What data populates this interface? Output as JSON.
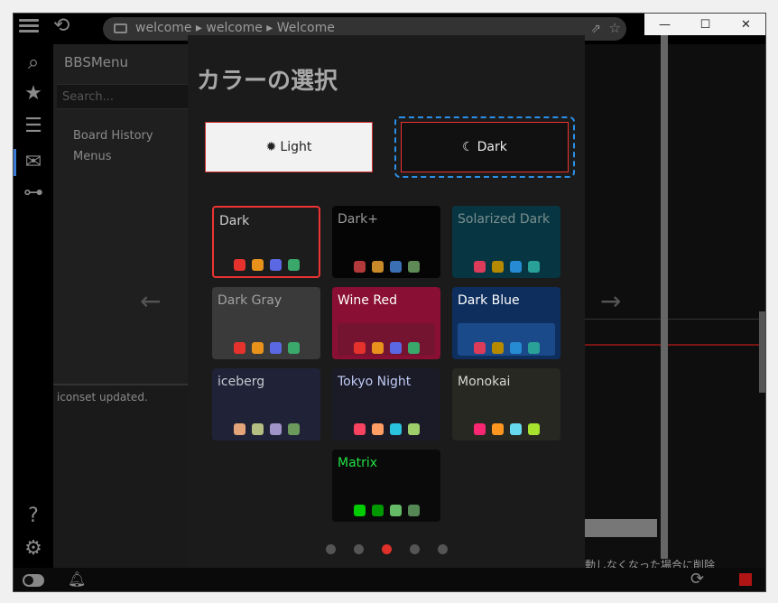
{
  "window": {
    "controls": [
      "—",
      "☐",
      "✕"
    ]
  },
  "toolbar": {
    "address": "welcome ▸ welcome ▸ Welcome"
  },
  "sidebar": {
    "title": "BBSMenu",
    "search_placeholder": "Search...",
    "items": [
      {
        "label": "Board History"
      },
      {
        "label": "Menus"
      }
    ],
    "log": "iconset updated."
  },
  "right": {
    "text": "動しなくなった場合に削除"
  },
  "dialog": {
    "title": "カラーの選択",
    "modes": {
      "light": "Light",
      "dark": "Dark",
      "selected": "dark"
    },
    "themes": [
      {
        "name": "Dark",
        "bg": "#1c1c1c",
        "fg": "#cfcfcf",
        "colors": [
          "#e5322c",
          "#e8921c",
          "#5b68e3",
          "#3aa86a"
        ],
        "selected": true
      },
      {
        "name": "Dark+",
        "bg": "#050505",
        "fg": "#999999",
        "colors": [
          "#b33a3a",
          "#c98a2a",
          "#3b6fb3",
          "#5e8a55"
        ]
      },
      {
        "name": "Solarized Dark",
        "bg": "#073642",
        "fg": "#7a8e8e",
        "colors": [
          "#dc3b5a",
          "#b58900",
          "#268bd2",
          "#2aa198"
        ]
      },
      {
        "name": "Dark Gray",
        "bg": "#3a3a3a",
        "fg": "#a0a0a0",
        "colors": [
          "#e5322c",
          "#e8921c",
          "#5b68e3",
          "#3aa86a"
        ]
      },
      {
        "name": "Wine Red",
        "bg": "#8a0f34",
        "fg": "#ffffff",
        "inner": "#751430",
        "colors": [
          "#e5322c",
          "#e8921c",
          "#5b68e3",
          "#3aa86a"
        ]
      },
      {
        "name": "Dark Blue",
        "bg": "#0e2f5e",
        "fg": "#ffffff",
        "inner": "#1a4a8a",
        "colors": [
          "#dc3b5a",
          "#b58900",
          "#268bd2",
          "#2aa198"
        ]
      },
      {
        "name": "iceberg",
        "bg": "#202337",
        "fg": "#c6c8d1",
        "colors": [
          "#e2a478",
          "#b4be82",
          "#a093c7",
          "#6b9a5c"
        ]
      },
      {
        "name": "Tokyo Night",
        "bg": "#1a1b26",
        "fg": "#c0caf5",
        "colors": [
          "#f7435f",
          "#ff9e64",
          "#2ac3de",
          "#9ece6a"
        ]
      },
      {
        "name": "Monokai",
        "bg": "#272822",
        "fg": "#d8d8d0",
        "colors": [
          "#f92672",
          "#fd971f",
          "#66d9ef",
          "#a6e22e"
        ]
      },
      {
        "name": "Matrix",
        "bg": "#0a0a0a",
        "fg": "#22e042",
        "colors": [
          "#00cc00",
          "#009900",
          "#66bb66",
          "#558855"
        ]
      }
    ],
    "pager": {
      "count": 5,
      "active": 2
    }
  }
}
